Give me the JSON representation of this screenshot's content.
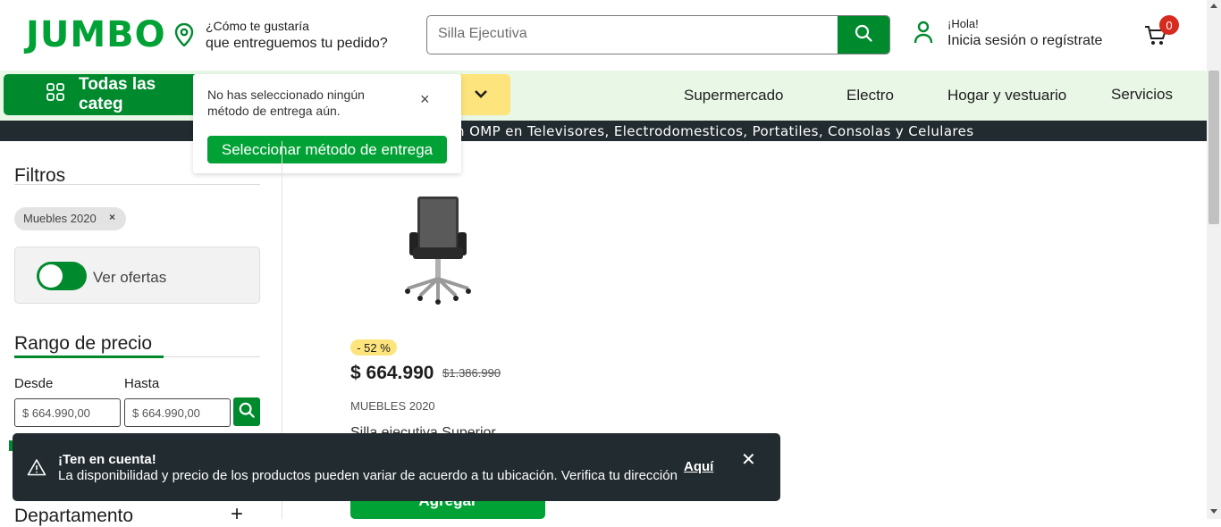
{
  "header": {
    "logo": "JUMBO",
    "delivery_line1": "¿Cómo te gustaría",
    "delivery_line2": "que entreguemos tu pedido?",
    "search_value": "Silla Ejecutiva",
    "greeting": "¡Hola!",
    "login": "Inicia sesión o regístrate",
    "cart_count": "0"
  },
  "nav": {
    "categories_label": "Todas las categ",
    "links": [
      "Supermercado",
      "Electro",
      "Hogar y vestuario",
      "Servicios"
    ]
  },
  "promo": {
    "text": "n OMP en Televisores, Electrodomesticos, Portatiles, Consolas y Celulares"
  },
  "popover": {
    "message": "No has seleccionado ningún método de entrega aún.",
    "close": "×",
    "button": "Seleccionar método de entrega"
  },
  "sidebar": {
    "filters_title": "Filtros",
    "chip_label": "Muebles 2020",
    "chip_remove": "×",
    "offers_label": "Ver ofertas",
    "offers_enabled": true,
    "range_title": "Rango de precio",
    "from_label": "Desde",
    "to_label": "Hasta",
    "from_value": "$ 664.990,00",
    "to_value": "$ 664.990,00",
    "department_title": "Departamento",
    "department_toggle": "+"
  },
  "product": {
    "discount": "- 52 %",
    "price": "$ 664.990",
    "old_price": "$1.386.990",
    "brand": "MUEBLES 2020",
    "name": "Silla ejecutiva Superior",
    "add_button": "Agregar"
  },
  "toast": {
    "title": "¡Ten en cuenta!",
    "message": "La disponibilidad y precio de los productos pueden variar de acuerdo a tu ubicación. Verifica tu dirección",
    "link": "Aquí",
    "close": "✕"
  },
  "colors": {
    "brand_green": "#00a235",
    "dark_green": "#008a2e",
    "nav_bg": "#e8f7e6",
    "promo_bg": "#212b30",
    "badge_red": "#d62b1e",
    "discount_yellow": "#fde47c"
  }
}
